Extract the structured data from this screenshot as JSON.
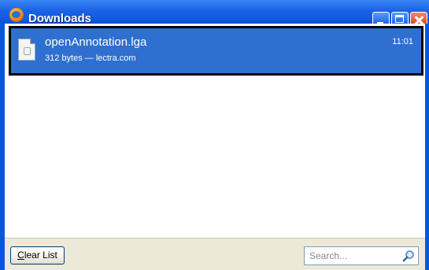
{
  "window": {
    "title": "Downloads"
  },
  "downloads": [
    {
      "file_name": "openAnnotation.lga",
      "meta": "312 bytes — lectra.com",
      "time": "11:01"
    }
  ],
  "toolbar": {
    "clear_label_mnemonic": "C",
    "clear_label_rest": "lear List",
    "search_placeholder": "Search...",
    "search_value": ""
  },
  "icons": {
    "app": "firefox-icon",
    "file": "file-icon",
    "search": "magnifier-icon",
    "minimize": "minimize-icon",
    "maximize": "maximize-icon",
    "close": "close-icon"
  },
  "colors": {
    "titlebar": "#0c52d8",
    "selection": "#2f6fcf",
    "close_button": "#e2522a",
    "toolbar_bg": "#ece9d8"
  }
}
